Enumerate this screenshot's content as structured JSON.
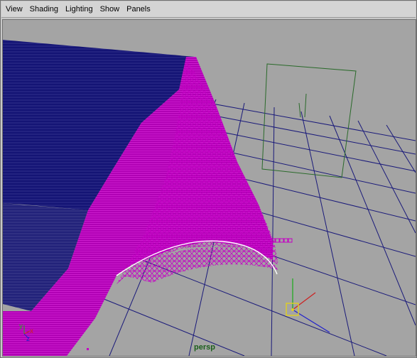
{
  "menubar": {
    "items": [
      "View",
      "Shading",
      "Lighting",
      "Show",
      "Panels"
    ]
  },
  "viewport": {
    "camera": "persp",
    "background_color": "#a4a4a4",
    "grid_color": "#1a1a7a",
    "wire_color": "#c400c4",
    "dense_wire_color": "#0b0b6e",
    "axis_labels": {
      "x": "x",
      "y": "y",
      "z": "z"
    }
  }
}
